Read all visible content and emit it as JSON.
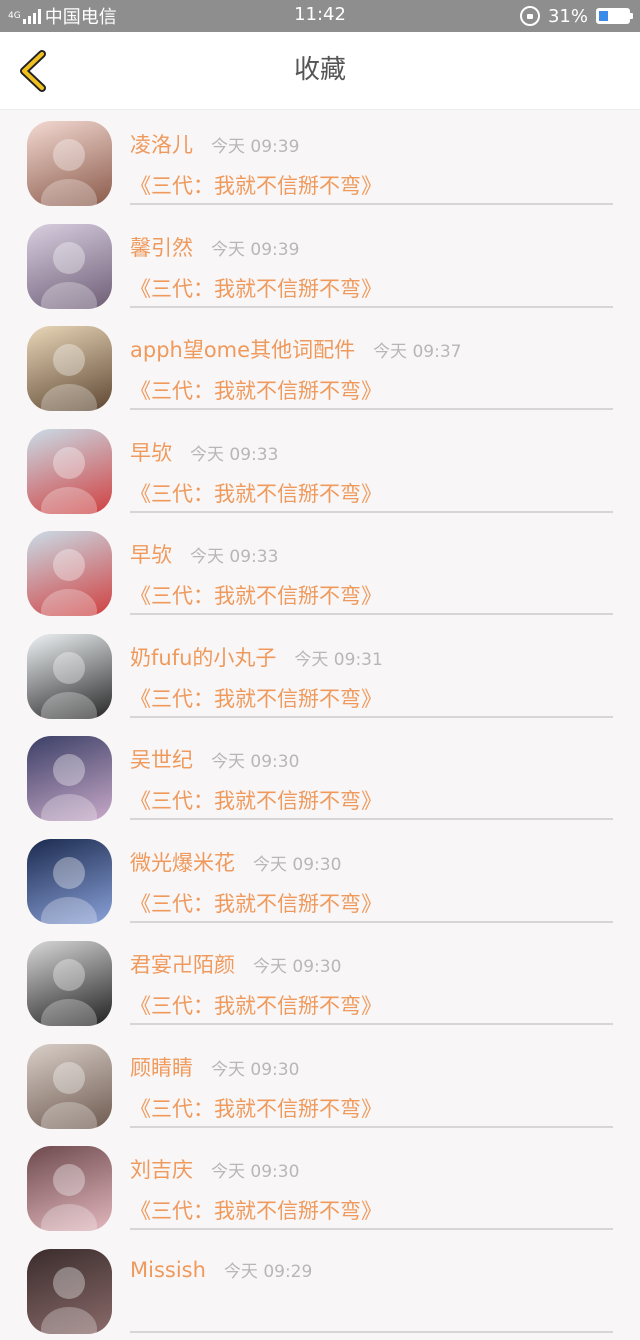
{
  "status_bar": {
    "network": "4G",
    "carrier": "中国电信",
    "time": "11:42",
    "battery_percent": "31%",
    "battery_level": 0.31
  },
  "header": {
    "back_icon": "chevron-left-icon",
    "title": "收藏",
    "accent_color": "#f0c020"
  },
  "colors": {
    "name": "#ef9a5c",
    "time": "#b7b7b7",
    "divider": "#d6d6d6"
  },
  "items": [
    {
      "name": "凌洛儿",
      "time": "今天 09:39",
      "work": "《三代：我就不信掰不弯》",
      "avatar": "avatar-photo"
    },
    {
      "name": "馨引然",
      "time": "今天 09:39",
      "work": "《三代：我就不信掰不弯》",
      "avatar": "avatar-photo"
    },
    {
      "name": "apph望ome其他词配件",
      "time": "今天 09:37",
      "work": "《三代：我就不信掰不弯》",
      "avatar": "avatar-photo"
    },
    {
      "name": "早欤",
      "time": "今天 09:33",
      "work": "《三代：我就不信掰不弯》",
      "avatar": "avatar-photo"
    },
    {
      "name": "早欤",
      "time": "今天 09:33",
      "work": "《三代：我就不信掰不弯》",
      "avatar": "avatar-photo"
    },
    {
      "name": "奶fufu的小丸子",
      "time": "今天 09:31",
      "work": "《三代：我就不信掰不弯》",
      "avatar": "avatar-photo"
    },
    {
      "name": "吴世纪",
      "time": "今天 09:30",
      "work": "《三代：我就不信掰不弯》",
      "avatar": "avatar-photo"
    },
    {
      "name": "微光爆米花",
      "time": "今天 09:30",
      "work": "《三代：我就不信掰不弯》",
      "avatar": "avatar-photo"
    },
    {
      "name": "君宴卍陌颜",
      "time": "今天 09:30",
      "work": "《三代：我就不信掰不弯》",
      "avatar": "avatar-photo"
    },
    {
      "name": "顾睛睛",
      "time": "今天 09:30",
      "work": "《三代：我就不信掰不弯》",
      "avatar": "avatar-photo"
    },
    {
      "name": "刘吉庆",
      "time": "今天 09:30",
      "work": "《三代：我就不信掰不弯》",
      "avatar": "avatar-photo"
    },
    {
      "name": "Missish",
      "time": "今天 09:29",
      "work": "",
      "avatar": "avatar-photo"
    }
  ]
}
